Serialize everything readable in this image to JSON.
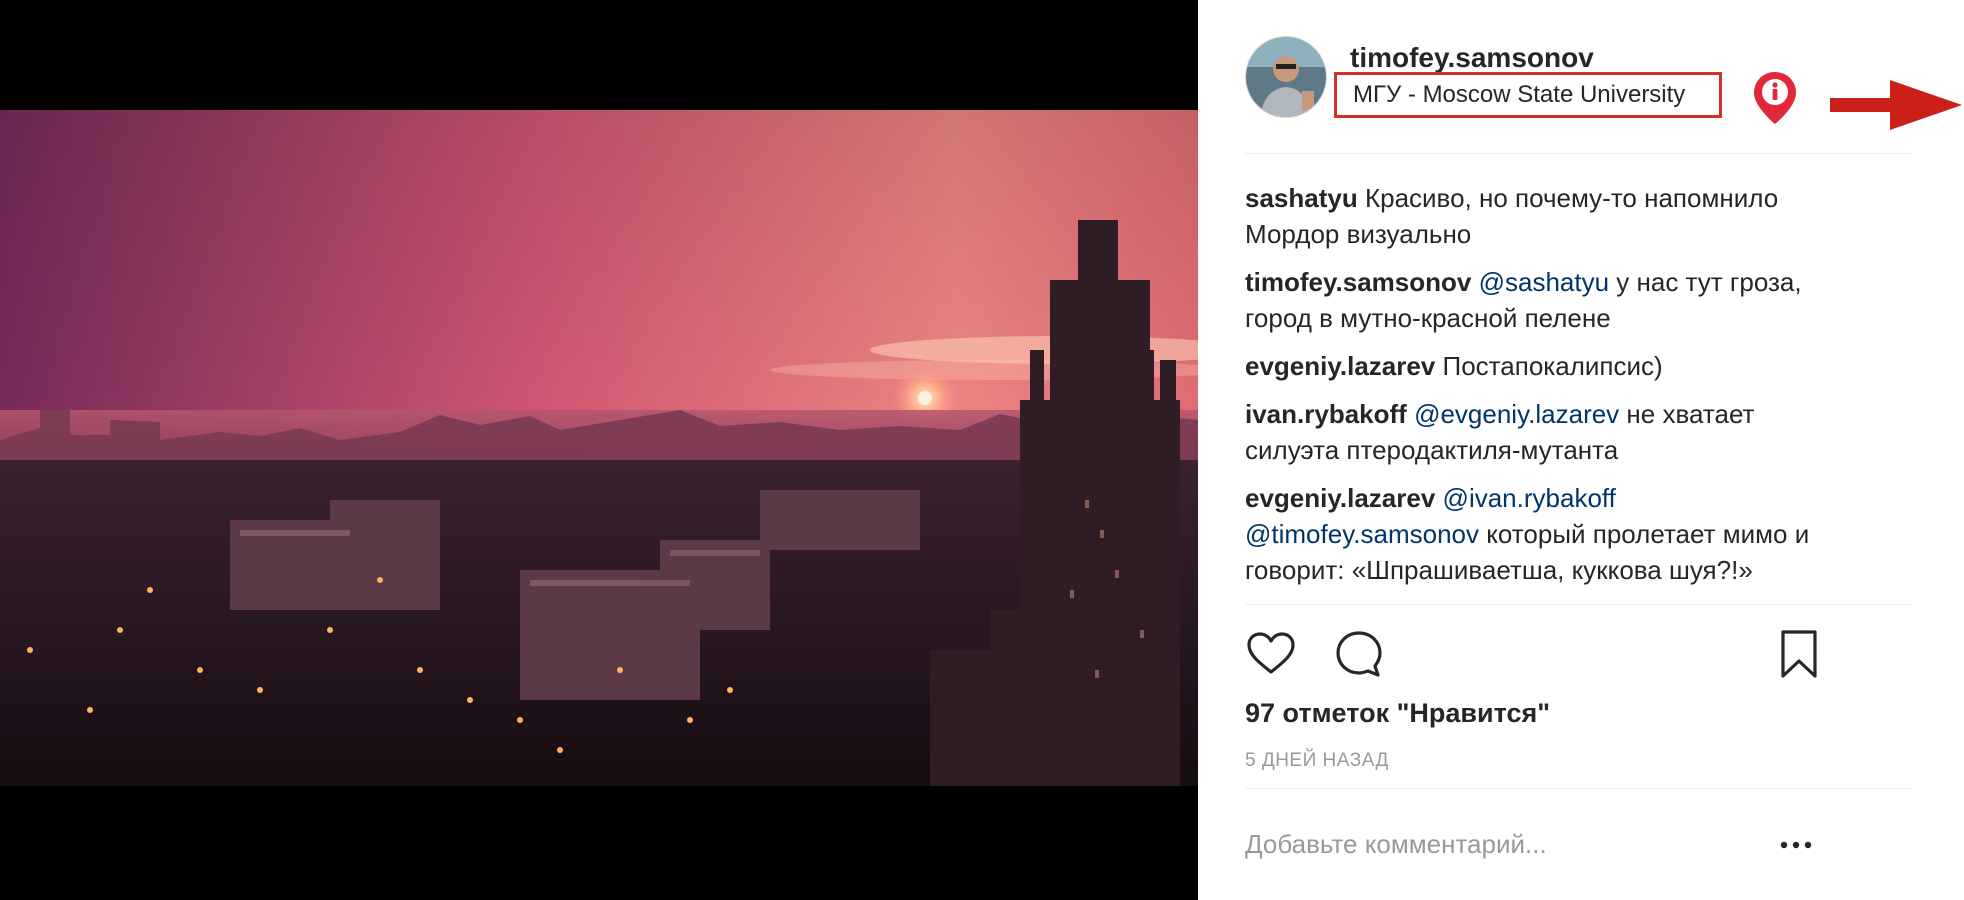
{
  "post": {
    "username": "timofey.samsonov",
    "location": "МГУ - Moscow State University"
  },
  "comments": [
    {
      "user": "sashatyu",
      "parts": [
        {
          "text": " Красиво, но почему-то напомнило Мордор визуально",
          "type": "text"
        }
      ]
    },
    {
      "user": "timofey.samsonov",
      "parts": [
        {
          "text": " ",
          "type": "text"
        },
        {
          "text": "@sashatyu",
          "type": "mention"
        },
        {
          "text": " у нас тут гроза, город в мутно-красной пелене",
          "type": "text"
        }
      ]
    },
    {
      "user": "evgeniy.lazarev",
      "parts": [
        {
          "text": " Постапокалипсис)",
          "type": "text"
        }
      ]
    },
    {
      "user": "ivan.rybakoff",
      "parts": [
        {
          "text": " ",
          "type": "text"
        },
        {
          "text": "@evgeniy.lazarev",
          "type": "mention"
        },
        {
          "text": " не хватает силуэта птеродактиля-мутанта",
          "type": "text"
        }
      ]
    },
    {
      "user": "evgeniy.lazarev",
      "parts": [
        {
          "text": " ",
          "type": "text"
        },
        {
          "text": "@ivan.rybakoff",
          "type": "mention"
        },
        {
          "text": " ",
          "type": "text"
        },
        {
          "text": "@timofey.samsonov",
          "type": "mention"
        },
        {
          "text": " который пролетает мимо и говорит: «Шпрашиваетша, куккова шуя?!»",
          "type": "text"
        }
      ]
    }
  ],
  "actions": {
    "like_icon": "heart-icon",
    "comment_icon": "speech-bubble-icon",
    "save_icon": "bookmark-icon"
  },
  "likes_text": "97 отметок \"Нравится\"",
  "time_text": "5 ДНЕЙ НАЗАД",
  "add_comment": {
    "placeholder": "Добавьте комментарий..."
  },
  "colors": {
    "annotation_red": "#d32f2f",
    "mention_blue": "#003569",
    "sky_pink": "#f07a82",
    "sky_purple": "#7a2d5c"
  }
}
